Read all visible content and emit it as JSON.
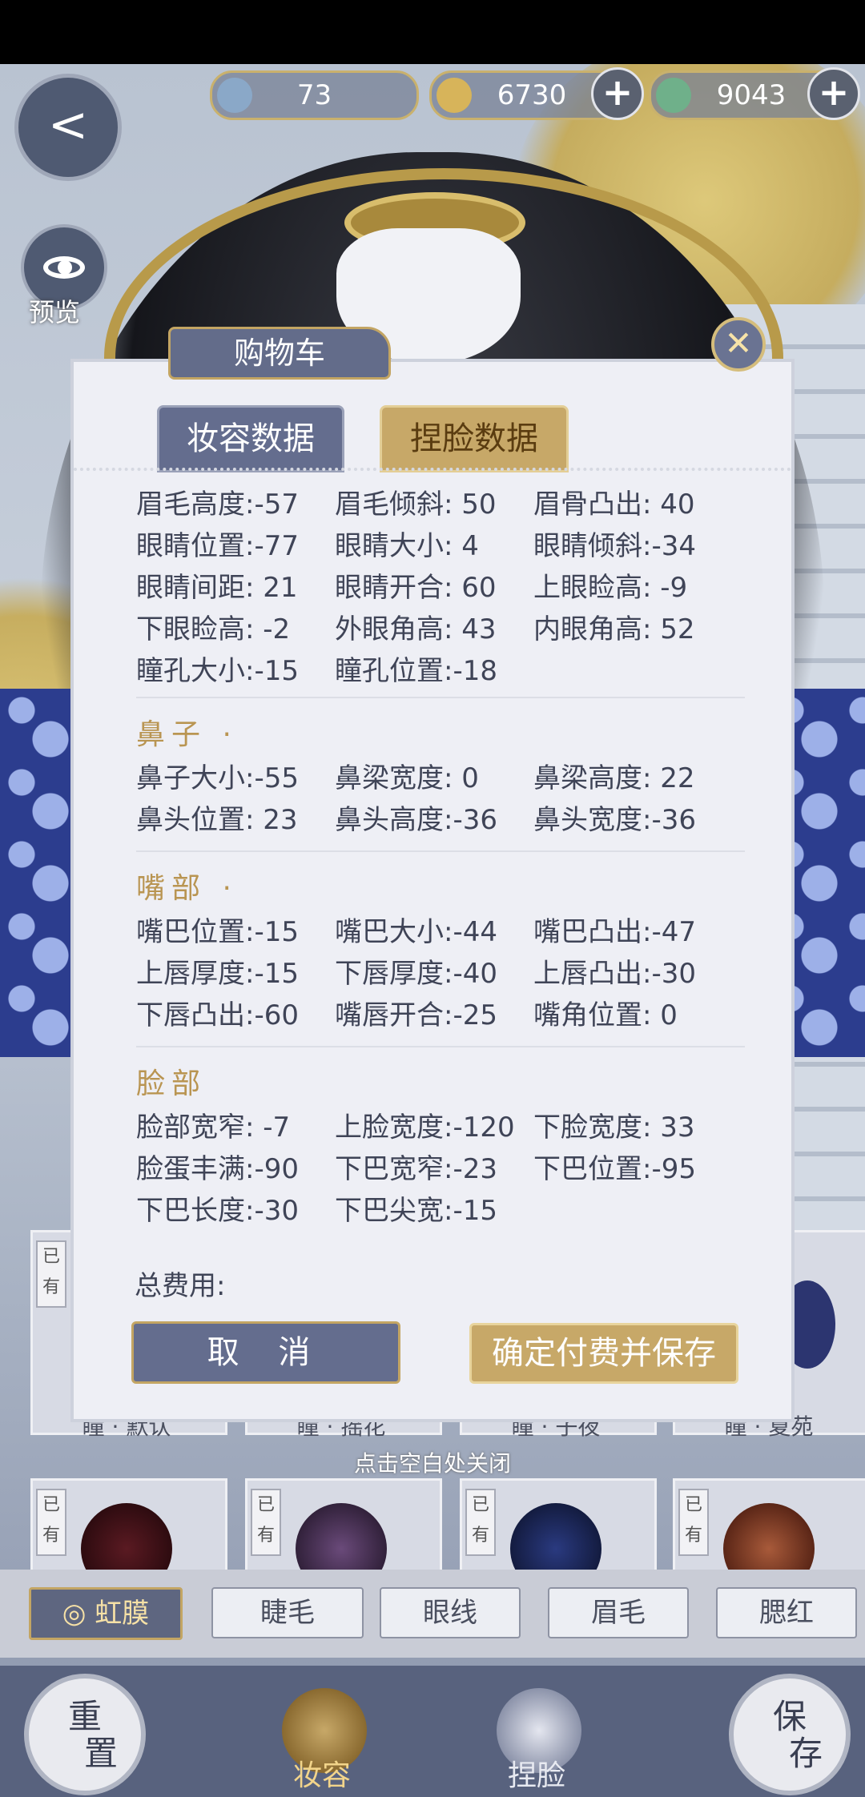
{
  "currency": {
    "jade": "73",
    "coins": "6730",
    "gems": "9043",
    "plus": "+"
  },
  "sidebar": {
    "back_glyph": "<",
    "preview_label": "预览",
    "help_glyph": "?"
  },
  "modal": {
    "title": "购物车",
    "close_glyph": "✕",
    "tabs": [
      "妆容数据",
      "捏脸数据"
    ],
    "eyes_rows": [
      [
        "眉毛高度:-57",
        "眉毛倾斜: 50",
        "眉骨凸出: 40"
      ],
      [
        "眼睛位置:-77",
        "眼睛大小:  4",
        "眼睛倾斜:-34"
      ],
      [
        "眼睛间距: 21",
        "眼睛开合: 60",
        "上眼睑高: -9"
      ],
      [
        "下眼睑高: -2",
        "外眼角高: 43",
        "内眼角高: 52"
      ],
      [
        "瞳孔大小:-15",
        "瞳孔位置:-18",
        ""
      ]
    ],
    "sections": [
      {
        "title": "鼻子 ·",
        "rows": [
          [
            "鼻子大小:-55",
            "鼻梁宽度:  0",
            "鼻梁高度: 22"
          ],
          [
            "鼻头位置: 23",
            "鼻头高度:-36",
            "鼻头宽度:-36"
          ]
        ]
      },
      {
        "title": "嘴部 ·",
        "rows": [
          [
            "嘴巴位置:-15",
            "嘴巴大小:-44",
            "嘴巴凸出:-47"
          ],
          [
            "上唇厚度:-15",
            "下唇厚度:-40",
            "上唇凸出:-30"
          ],
          [
            "下唇凸出:-60",
            "嘴唇开合:-25",
            "嘴角位置:  0"
          ]
        ]
      },
      {
        "title": "脸部",
        "rows": [
          [
            "脸部宽窄: -7",
            "上脸宽度:-120",
            "下脸宽度: 33"
          ],
          [
            "脸蛋丰满:-90",
            "下巴宽窄:-23",
            "下巴位置:-95"
          ],
          [
            "下巴长度:-30",
            "下巴尖宽:-15",
            ""
          ]
        ]
      }
    ],
    "total_label": "总费用:",
    "cancel": "取 消",
    "confirm": "确定付费并保存"
  },
  "close_hint": "点击空白处关闭",
  "items": {
    "owned_tag": "已有",
    "names": [
      "瞳 · 默认",
      "瞳 · 摇花",
      "瞳 · 子夜",
      "瞳 · 夏苑"
    ]
  },
  "categories": [
    "◎ 虹膜",
    "睫毛",
    "眼线",
    "眉毛",
    "腮红"
  ],
  "bottom": {
    "reset": [
      "重",
      "置"
    ],
    "makeup": "妆容",
    "face": "捏脸",
    "save": [
      "保",
      "存"
    ]
  },
  "colors": {
    "accent_gold": "#c7a868",
    "panel_blue": "#646d8e",
    "section_gold": "#b99552"
  }
}
